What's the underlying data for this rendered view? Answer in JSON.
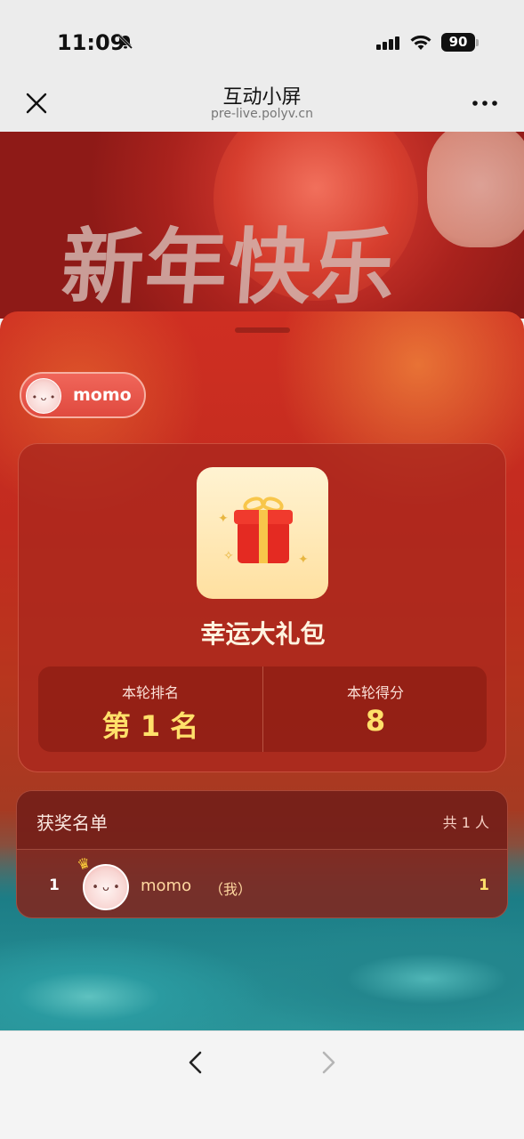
{
  "status": {
    "time": "11:09",
    "battery": "90"
  },
  "header": {
    "title": "互动小屏",
    "url": "pre-live.polyv.cn",
    "close_icon": "close-icon",
    "more_icon": "more-icon",
    "more_glyph": "•••"
  },
  "banner": {
    "title": "新年快乐"
  },
  "user": {
    "name": "momo"
  },
  "prize": {
    "name": "幸运大礼包",
    "icon": "gift-icon"
  },
  "stats": {
    "rank_label": "本轮排名",
    "rank_value": "第 1 名",
    "score_label": "本轮得分",
    "score_value": "8"
  },
  "winners": {
    "title": "获奖名单",
    "count": "共 1 人",
    "rows": [
      {
        "rank": "1",
        "name": "momo",
        "me_tag": "（我）",
        "score": "1"
      }
    ]
  },
  "colors": {
    "accent_gold": "#ffe06a",
    "panel_red": "#c22b1f",
    "sea_teal": "#2a9499"
  },
  "toolbar": {
    "back_icon": "chevron-left-icon",
    "forward_icon": "chevron-right-icon"
  }
}
